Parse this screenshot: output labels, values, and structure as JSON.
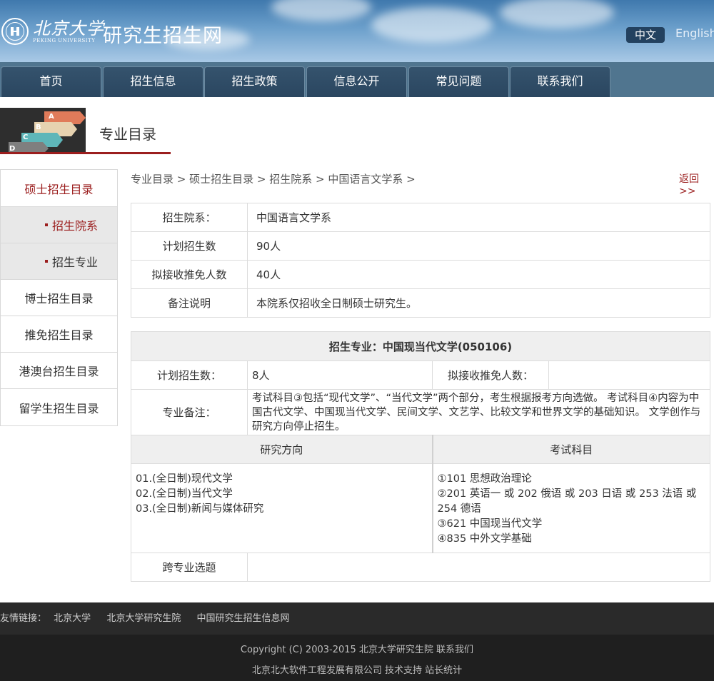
{
  "header": {
    "logo_cn": "北京大学",
    "logo_en": "PEKING UNIVERSITY",
    "site_title": "研究生招生网",
    "lang_cn": "中文",
    "lang_en": "English"
  },
  "nav": [
    "首页",
    "招生信息",
    "招生政策",
    "信息公开",
    "常见问题",
    "联系我们"
  ],
  "banner": {
    "title": "专业目录",
    "letters": [
      "A",
      "B",
      "C",
      "D"
    ]
  },
  "sidebar": {
    "items": [
      {
        "label": "硕士招生目录"
      },
      {
        "label": "招生院系"
      },
      {
        "label": "招生专业"
      },
      {
        "label": "博士招生目录"
      },
      {
        "label": "推免招生目录"
      },
      {
        "label": "港澳台招生目录"
      },
      {
        "label": "留学生招生目录"
      }
    ]
  },
  "breadcrumb": "专业目录 > 硕士招生目录 > 招生院系 > 中国语言文学系 >",
  "back": "返回>>",
  "dept": {
    "rows": [
      {
        "k": "招生院系：",
        "v": "中国语言文学系"
      },
      {
        "k": "计划招生数",
        "v": "90人"
      },
      {
        "k": "拟接收推免人数",
        "v": "40人"
      },
      {
        "k": "备注说明",
        "v": "本院系仅招收全日制硕士研究生。"
      }
    ]
  },
  "major": {
    "header": "招生专业：中国现当代文学(050106)",
    "plan_label": "计划招生数：",
    "plan_value": "8人",
    "exempt_label": "拟接收推免人数：",
    "exempt_value": "",
    "note_label": "专业备注：",
    "note_value": "考试科目③包括“现代文学”、“当代文学”两个部分，考生根据报考方向选做。 考试科目④内容为中国古代文学、中国现当代文学、民间文学、文艺学、比较文学和世界文学的基础知识。 文学创作与研究方向停止招生。",
    "dir_header": "研究方向",
    "exam_header": "考试科目",
    "directions": [
      "01.(全日制)现代文学",
      "02.(全日制)当代文学",
      "03.(全日制)新闻与媒体研究"
    ],
    "exams": [
      "①101 思想政治理论",
      "②201 英语一 或 202 俄语 或 203 日语 或 253 法语 或 254 德语",
      "③621 中国现当代文学",
      "④835 中外文学基础"
    ],
    "cross_label": "跨专业选题",
    "cross_value": ""
  },
  "footer": {
    "links_label": "友情链接：",
    "links": [
      "北京大学",
      "北京大学研究生院",
      "中国研究生招生信息网"
    ],
    "copyright": "Copyright (C) 2003-2015 北京大学研究生院 联系我们",
    "support": "北京北大软件工程发展有限公司 技术支持 站长统计"
  }
}
